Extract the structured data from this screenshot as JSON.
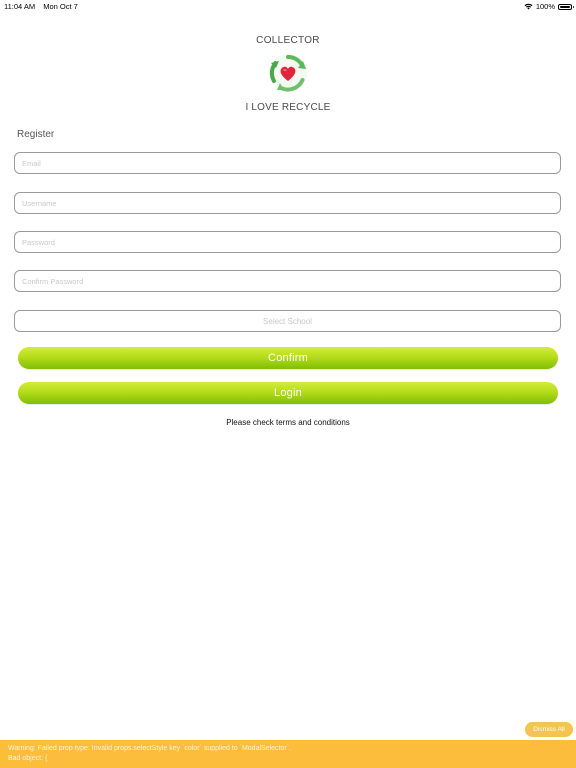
{
  "status_bar": {
    "time": "11:04 AM",
    "date": "Mon Oct 7",
    "battery": "100%",
    "battery_level": 1.0
  },
  "header": {
    "app_name": "COLLECTOR",
    "logo_icon": "recycle-heart-icon",
    "tagline": "I LOVE RECYCLE"
  },
  "form": {
    "title": "Register",
    "email_placeholder": "Email",
    "username_placeholder": "Username",
    "password_placeholder": "Password",
    "confirm_password_placeholder": "Confirm Password",
    "select_school_label": "Select School"
  },
  "buttons": {
    "confirm_label": "Confirm",
    "login_label": "Login"
  },
  "terms_text": "Please check terms and conditions",
  "warning": {
    "dismiss_label": "Dismiss All",
    "line1": "Warning: Failed prop type: Invalid props.selectStyle key `color` supplied to `ModalSelector`.",
    "line2": "Bad object: {"
  },
  "colors": {
    "button_top": "#d4ec3a",
    "button_bottom": "#7fbe06",
    "warning_bg": "#fbbd3b",
    "logo_green": "#5cb85c",
    "logo_heart": "#e0263c"
  }
}
